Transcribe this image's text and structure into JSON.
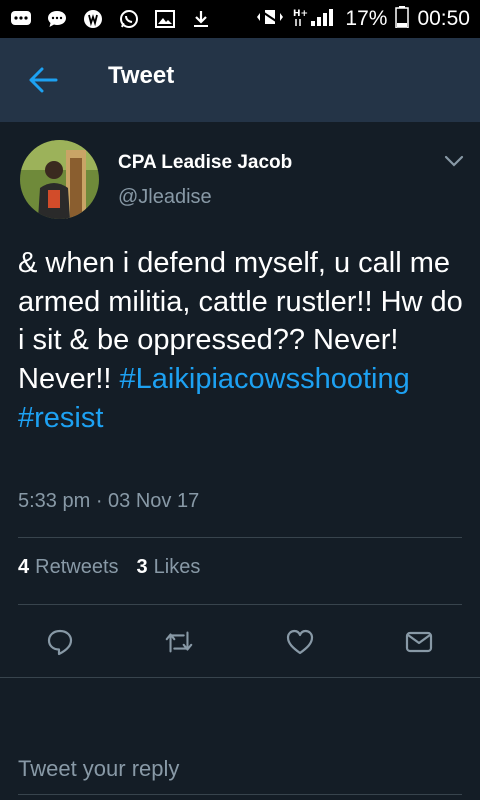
{
  "status_bar": {
    "battery_percent": "17%",
    "time": "00:50",
    "network": "H+"
  },
  "header": {
    "title": "Tweet"
  },
  "tweet": {
    "author_name": "CPA Leadise Jacob",
    "author_handle": "@Jleadise",
    "text_plain": "& when i defend myself, u call me armed militia, cattle rustler!! Hw do i sit & be oppressed?? Never! Never!!",
    "hashtags": [
      "#Laikipiacowsshooting",
      "#resist"
    ],
    "timestamp": "5:33 pm · 03 Nov 17",
    "retweets_count": "4",
    "retweets_label": "Retweets",
    "likes_count": "3",
    "likes_label": "Likes"
  },
  "reply": {
    "placeholder": "Tweet your reply"
  },
  "colors": {
    "background": "#141d26",
    "header": "#243447",
    "accent": "#1da1f2",
    "secondary_text": "#8899a6",
    "divider": "#38444d"
  }
}
